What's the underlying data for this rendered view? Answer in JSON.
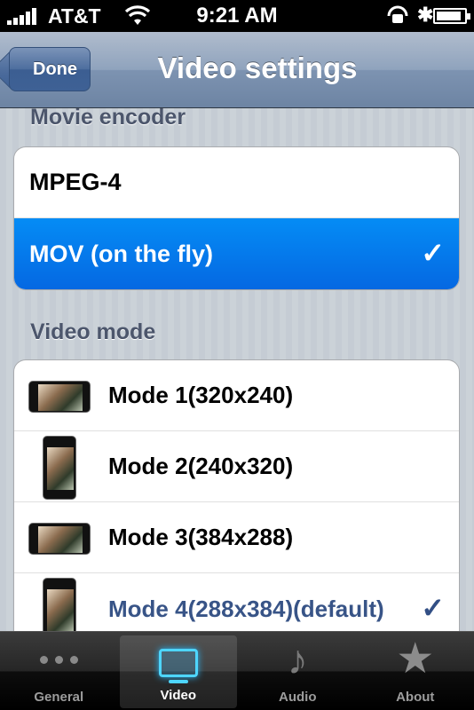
{
  "status_bar": {
    "carrier": "AT&T",
    "time": "9:21 AM",
    "signal_bars": 5,
    "battery_level": 0.9
  },
  "navbar": {
    "back_label": "Done",
    "title": "Video settings"
  },
  "encoder_section": {
    "header": "Movie encoder",
    "options": [
      {
        "label": "MPEG-4",
        "selected": false
      },
      {
        "label": "MOV (on the fly)",
        "selected": true
      }
    ],
    "check_glyph": "✓"
  },
  "mode_section": {
    "header": "Video mode",
    "options": [
      {
        "label": "Mode 1(320x240)",
        "orientation": "landscape",
        "checked": false
      },
      {
        "label": "Mode 2(240x320)",
        "orientation": "portrait",
        "checked": false
      },
      {
        "label": "Mode 3(384x288)",
        "orientation": "landscape",
        "checked": false
      },
      {
        "label": "Mode 4(288x384)(default)",
        "orientation": "portrait",
        "checked": true
      }
    ]
  },
  "tabbar": {
    "tabs": [
      {
        "label": "General",
        "icon": "more-dots-icon",
        "active": false
      },
      {
        "label": "Video",
        "icon": "tv-icon",
        "active": true
      },
      {
        "label": "Audio",
        "icon": "music-note-icon",
        "active": false
      },
      {
        "label": "About",
        "icon": "star-icon",
        "active": false
      }
    ]
  },
  "colors": {
    "selection_blue": "#0568e2",
    "checked_text": "#385487",
    "section_header": "#4c566c"
  }
}
